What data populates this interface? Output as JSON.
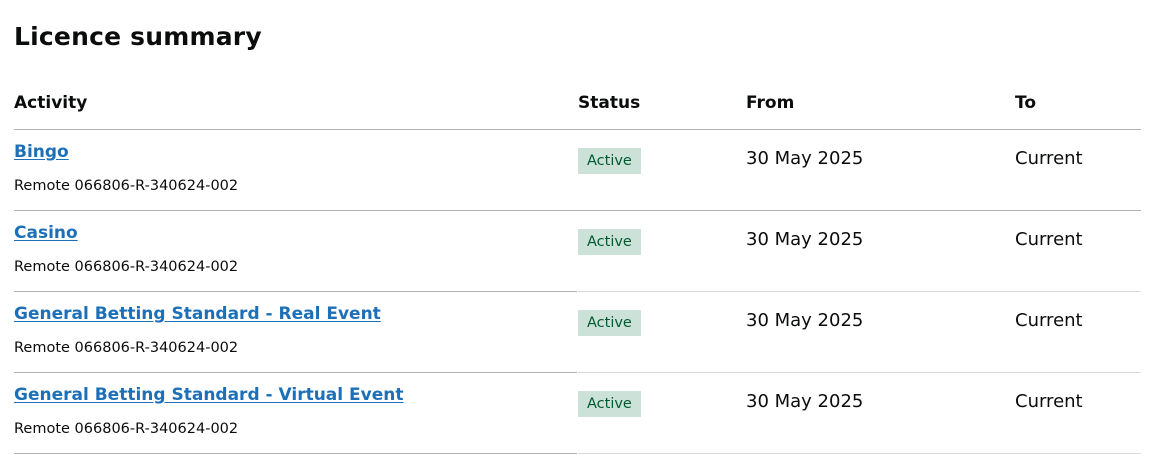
{
  "page": {
    "title": "Licence summary"
  },
  "table": {
    "headers": {
      "activity": "Activity",
      "status": "Status",
      "from": "From",
      "to": "To"
    },
    "rows": [
      {
        "activity": "Bingo",
        "reference": "Remote 066806-R-340624-002",
        "status": "Active",
        "from": "30 May 2025",
        "to": "Current"
      },
      {
        "activity": "Casino",
        "reference": "Remote 066806-R-340624-002",
        "status": "Active",
        "from": "30 May 2025",
        "to": "Current"
      },
      {
        "activity": "General Betting Standard - Real Event",
        "reference": "Remote 066806-R-340624-002",
        "status": "Active",
        "from": "30 May 2025",
        "to": "Current"
      },
      {
        "activity": "General Betting Standard - Virtual Event",
        "reference": "Remote 066806-R-340624-002",
        "status": "Active",
        "from": "30 May 2025",
        "to": "Current"
      }
    ]
  },
  "colors": {
    "link": "#1d70b8",
    "status_tag_background": "#cce2d8",
    "status_tag_text": "#005a30",
    "divider": "#b1b4b6"
  }
}
